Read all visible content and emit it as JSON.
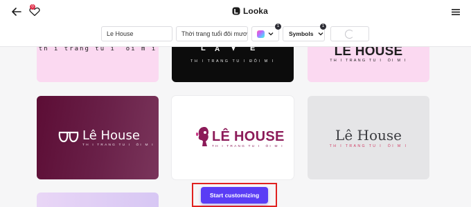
{
  "header": {
    "brand": "Looka",
    "favorites_count": "0",
    "name_value": "Le House",
    "slogan_value": "Thời trang tuổi đôi mươi",
    "color_count": "1",
    "symbols_label": "Symbols",
    "symbols_count": "1"
  },
  "cards": {
    "pink_top": {
      "tagline": "th i trang tu i  ói m i"
    },
    "black_top": {
      "letters": [
        "L",
        "A",
        "E"
      ],
      "tagline": "TH I TRANG TU I ĐÔI M I"
    },
    "pink2_top": {
      "name": "LE HOUSE",
      "tagline": "TH I TRANG TU I  ÓI M I"
    },
    "maroon": {
      "name": "Lê House",
      "tagline": "TH I TRANG TU I  ÓI M I"
    },
    "white": {
      "name": "LÊ HOUSE",
      "tagline": "TH I TRANG TU I  ÓI M I"
    },
    "gray": {
      "name": "Lê House",
      "tagline": "TH I TRANG TU I  ÓI M I"
    }
  },
  "cta": {
    "label": "Start customizing"
  },
  "colors": {
    "accent": "#5a3df5",
    "highlight": "#e0211f",
    "card_pink": "#fbd9f1",
    "card_maroon": "#5c0d35",
    "brand_magenta": "#8c1b59",
    "tag_pink": "#d13a63"
  },
  "icons": [
    "back-arrow-icon",
    "heart-icon",
    "looka-logo-icon",
    "hamburger-menu-icon",
    "chevron-down-icon",
    "loading-spinner-icon",
    "glasses-logo-icon",
    "woman-silhouette-logo-icon"
  ]
}
